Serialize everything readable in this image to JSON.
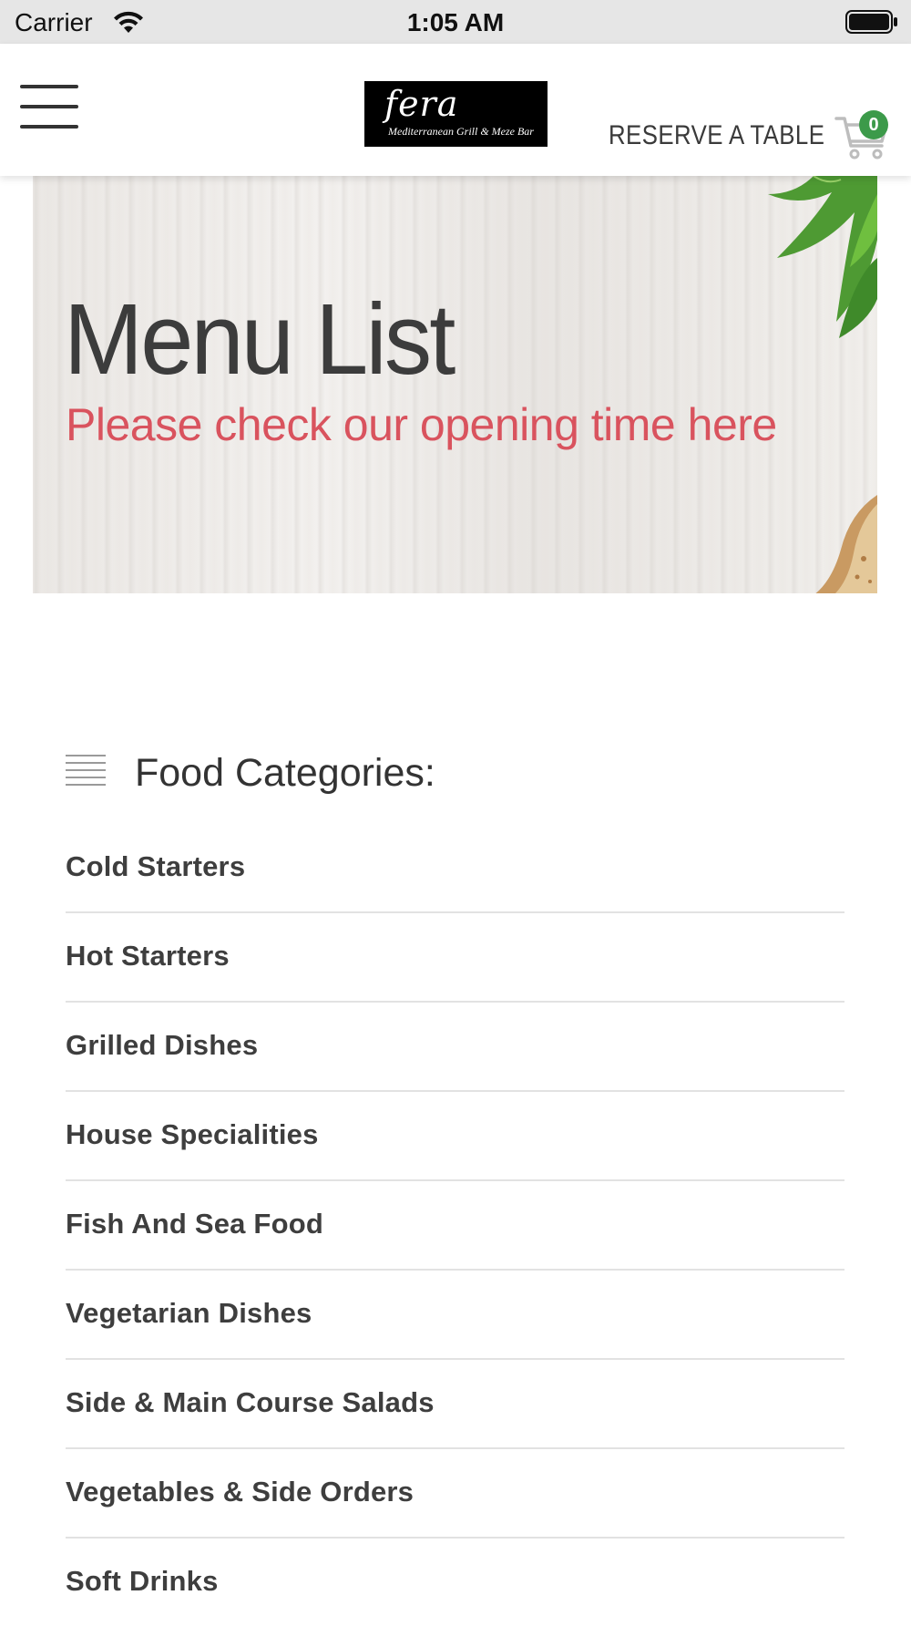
{
  "status_bar": {
    "carrier": "Carrier",
    "time": "1:05 AM",
    "wifi_icon": "wifi-icon",
    "battery_icon": "battery-full-icon"
  },
  "header": {
    "menu_icon": "hamburger-menu-icon",
    "logo": {
      "name": "fera",
      "tagline": "Mediterranean Grill & Meze Bar"
    },
    "reserve_label": "RESERVE A TABLE",
    "cart_icon": "shopping-cart-icon",
    "cart_count": "0",
    "cart_badge_color": "#3c9a4a"
  },
  "banner": {
    "title": "Menu List",
    "subtitle": "Please check our opening time here",
    "subtitle_color": "#d9535e"
  },
  "categories": {
    "icon": "list-lines-icon",
    "title": "Food Categories:",
    "items": [
      "Cold Starters",
      "Hot Starters",
      "Grilled Dishes",
      "House Specialities",
      "Fish And Sea Food",
      "Vegetarian Dishes",
      "Side & Main Course Salads",
      "Vegetables & Side Orders",
      "Soft Drinks"
    ]
  }
}
